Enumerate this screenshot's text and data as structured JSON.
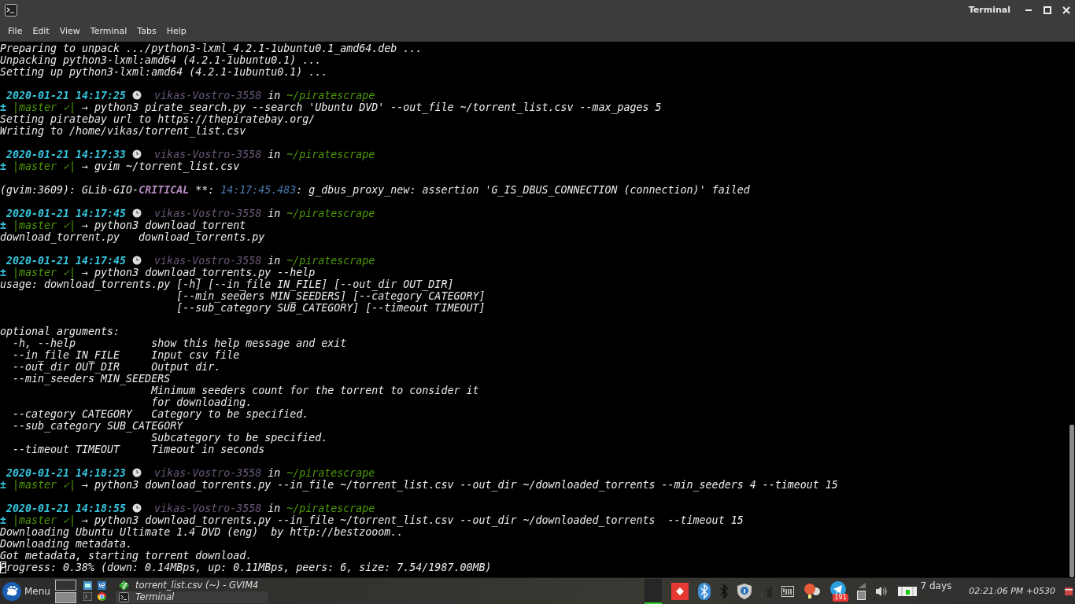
{
  "window": {
    "title": "Terminal"
  },
  "menu": [
    "File",
    "Edit",
    "View",
    "Terminal",
    "Tabs",
    "Help"
  ],
  "terminal": {
    "lines": [
      {
        "kind": "output",
        "text": "Preparing to unpack .../python3-lxml_4.2.1-1ubuntu0.1_amd64.deb ..."
      },
      {
        "kind": "output",
        "text": "Unpacking python3-lxml:amd64 (4.2.1-1ubuntu0.1) ..."
      },
      {
        "kind": "output",
        "text": "Setting up python3-lxml:amd64 (4.2.1-1ubuntu0.1) ..."
      },
      {
        "kind": "blank"
      },
      {
        "kind": "header",
        "date": "2020-01-21 14:17:25",
        "host": "vikas-Vostro-3558",
        "word": "in",
        "path": "~/piratescrape"
      },
      {
        "kind": "command",
        "sign": "±",
        "branch": "|master ✓|",
        "arrow": "→",
        "command": "python3 pirate_search.py --search 'Ubuntu DVD' --out_file ~/torrent_list.csv --max_pages 5"
      },
      {
        "kind": "output",
        "text": "Setting piratebay url to https://thepiratebay.org/"
      },
      {
        "kind": "output",
        "text": "Writing to /home/vikas/torrent_list.csv"
      },
      {
        "kind": "blank"
      },
      {
        "kind": "header",
        "date": "2020-01-21 14:17:33",
        "host": "vikas-Vostro-3558",
        "word": "in",
        "path": "~/piratescrape"
      },
      {
        "kind": "command",
        "sign": "±",
        "branch": "|master ✓|",
        "arrow": "→",
        "command": "gvim ~/torrent_list.csv"
      },
      {
        "kind": "blank"
      },
      {
        "kind": "log",
        "segments": [
          {
            "kind": "plain",
            "text": "(gvim:3609): GLib-GIO-"
          },
          {
            "kind": "critical",
            "text": "CRITICAL"
          },
          {
            "kind": "plain",
            "text": " **: "
          },
          {
            "kind": "time",
            "text": "14:17:45.483"
          },
          {
            "kind": "plain",
            "text": ": g_dbus_proxy_new: assertion 'G_IS_DBUS_CONNECTION (connection)' failed"
          }
        ]
      },
      {
        "kind": "blank"
      },
      {
        "kind": "header",
        "date": "2020-01-21 14:17:45",
        "host": "vikas-Vostro-3558",
        "word": "in",
        "path": "~/piratescrape"
      },
      {
        "kind": "command",
        "sign": "±",
        "branch": "|master ✓|",
        "arrow": "→",
        "command": "python3 download_torrent"
      },
      {
        "kind": "output",
        "text": "download_torrent.py   download_torrents.py"
      },
      {
        "kind": "blank"
      },
      {
        "kind": "header",
        "date": "2020-01-21 14:17:45",
        "host": "vikas-Vostro-3558",
        "word": "in",
        "path": "~/piratescrape"
      },
      {
        "kind": "command",
        "sign": "±",
        "branch": "|master ✓|",
        "arrow": "→",
        "command": "python3 download_torrents.py --help"
      },
      {
        "kind": "output",
        "text": "usage: download_torrents.py [-h] [--in_file IN_FILE] [--out_dir OUT_DIR]"
      },
      {
        "kind": "output",
        "text": "                            [--min_seeders MIN_SEEDERS] [--category CATEGORY]"
      },
      {
        "kind": "output",
        "text": "                            [--sub_category SUB_CATEGORY] [--timeout TIMEOUT]"
      },
      {
        "kind": "blank"
      },
      {
        "kind": "output",
        "text": "optional arguments:"
      },
      {
        "kind": "output",
        "text": "  -h, --help            show this help message and exit"
      },
      {
        "kind": "output",
        "text": "  --in_file IN_FILE     Input csv file"
      },
      {
        "kind": "output",
        "text": "  --out_dir OUT_DIR     Output dir."
      },
      {
        "kind": "output",
        "text": "  --min_seeders MIN_SEEDERS"
      },
      {
        "kind": "output",
        "text": "                        Minimum seeders count for the torrent to consider it"
      },
      {
        "kind": "output",
        "text": "                        for downloading."
      },
      {
        "kind": "output",
        "text": "  --category CATEGORY   Category to be specified."
      },
      {
        "kind": "output",
        "text": "  --sub_category SUB_CATEGORY"
      },
      {
        "kind": "output",
        "text": "                        Subcategory to be specified."
      },
      {
        "kind": "output",
        "text": "  --timeout TIMEOUT     Timeout in seconds"
      },
      {
        "kind": "blank"
      },
      {
        "kind": "header",
        "date": "2020-01-21 14:18:23",
        "host": "vikas-Vostro-3558",
        "word": "in",
        "path": "~/piratescrape"
      },
      {
        "kind": "command",
        "sign": "±",
        "branch": "|master ✓|",
        "arrow": "→",
        "command": "python3 download_torrents.py --in_file ~/torrent_list.csv --out_dir ~/downloaded_torrents --min_seeders 4 --timeout 15"
      },
      {
        "kind": "blank"
      },
      {
        "kind": "header",
        "date": "2020-01-21 14:18:55",
        "host": "vikas-Vostro-3558",
        "word": "in",
        "path": "~/piratescrape"
      },
      {
        "kind": "command",
        "sign": "±",
        "branch": "|master ✓|",
        "arrow": "→",
        "command": "python3 download_torrents.py --in_file ~/torrent_list.csv --out_dir ~/downloaded_torrents  --timeout 15"
      },
      {
        "kind": "output",
        "text": "Downloading Ubuntu Ultimate 1.4 DVD (eng)  by http://bestzooom.."
      },
      {
        "kind": "output",
        "text": "Downloading metadata."
      },
      {
        "kind": "output",
        "text": "Got metadata, starting torrent download."
      },
      {
        "kind": "output",
        "text": "Progress: 0.38% (down: 0.14MBps, up: 0.11MBps, peers: 6, size: 7.54/1987.00MB)",
        "cursor": true
      }
    ]
  },
  "taskbar": {
    "menu_label": "Menu",
    "windows": [
      {
        "title": "torrent_list.csv (~) - GVIM4",
        "selected": false
      },
      {
        "title": "Terminal",
        "selected": true
      }
    ],
    "telegram_badge": "191",
    "battery": "7 days",
    "clock": "02:21:06 PM +0530"
  }
}
